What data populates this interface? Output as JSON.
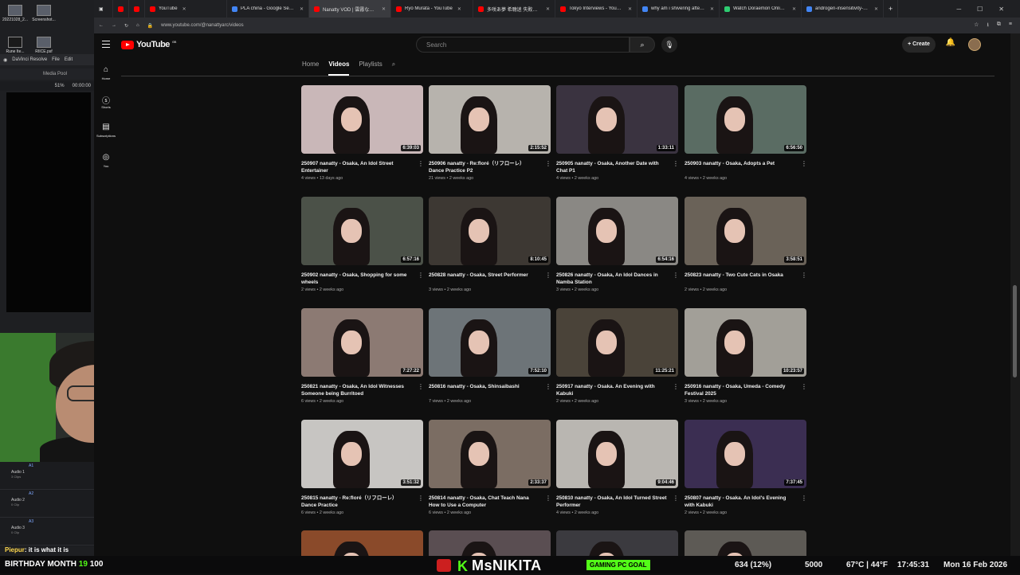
{
  "desktop": {
    "icons": [
      {
        "label": "20221028_2...",
        "icon": "image-file-icon"
      },
      {
        "label": "Screenshot...",
        "icon": "image-file-icon"
      },
      {
        "label": "Rune Ite...",
        "icon": "app-icon"
      },
      {
        "label": "RIICE.psf",
        "icon": "file-icon"
      }
    ],
    "resolve": {
      "app_name": "DaVinci Resolve",
      "menu": [
        "File",
        "Edit"
      ],
      "media_pool": "Media Pool",
      "zoom": "51%",
      "timecode": "00:00:00"
    },
    "audio_tracks": [
      {
        "tag": "A1",
        "name": "Audio 1",
        "clips": "3 Clips"
      },
      {
        "tag": "A2",
        "name": "Audio 2",
        "clips": "0 Clip"
      },
      {
        "tag": "A3",
        "name": "Audio 3",
        "clips": "0 Clip"
      }
    ]
  },
  "browser": {
    "tabs": [
      {
        "label": "YouTube",
        "color": "#ff0000"
      },
      {
        "label": "PLA china - Google Search",
        "color": "#4285f4"
      },
      {
        "label": "Nanatty VOD | 雲霧なな5...",
        "color": "#ff0000"
      },
      {
        "label": "Ryo Murata - YouTube",
        "color": "#ff0000"
      },
      {
        "label": "多咲あ夢 希聴迷 失敗回避...",
        "color": "#ff0000"
      },
      {
        "label": "Tokyo Interviews - YouTube",
        "color": "#ff0000"
      },
      {
        "label": "why am i shivering after fo...",
        "color": "#4285f4"
      },
      {
        "label": "Watch Doraemon Online in...",
        "color": "#2ecc71"
      },
      {
        "label": "androgen-insensitivity-syn...",
        "color": "#4285f4"
      }
    ],
    "active_tab_index": 2,
    "url": "www.youtube.com/@nanattyarc/videos"
  },
  "youtube": {
    "logo_text": "YouTube",
    "country_code": "GB",
    "search_placeholder": "Search",
    "create_label": "Create",
    "sidebar": [
      {
        "label": "Home",
        "icon": "home-icon"
      },
      {
        "label": "Shorts",
        "icon": "shorts-icon"
      },
      {
        "label": "Subscriptions",
        "icon": "subscriptions-icon"
      },
      {
        "label": "You",
        "icon": "user-icon"
      }
    ],
    "channel_tabs": [
      {
        "label": "Home",
        "selected": false
      },
      {
        "label": "Videos",
        "selected": true
      },
      {
        "label": "Playlists",
        "selected": false
      }
    ],
    "videos": [
      {
        "title": "250907    nanatty - Osaka, An Idol Street Entertainer",
        "meta": "4 views • 13 days ago",
        "duration": "6:39:03",
        "bg": "#c9b7b8"
      },
      {
        "title": "250906    nanatty - Re:floré（リフローレ） Dance Practice P2",
        "meta": "21 views • 2 weeks ago",
        "duration": "2:15:52",
        "bg": "#b7b3ad"
      },
      {
        "title": "250905    nanatty - Osaka, Another Date with Chat P1",
        "meta": "4 views • 2 weeks ago",
        "duration": "1:33:11",
        "bg": "#3a3340"
      },
      {
        "title": "250903    nanatty - Osaka, Adopts a Pet",
        "meta": "4 views • 2 weeks ago",
        "duration": "6:56:50",
        "bg": "#5a6c63"
      },
      {
        "title": "250902    nanatty - Osaka, Shopping for some wheels",
        "meta": "2 views • 2 weeks ago",
        "duration": "6:57:16",
        "bg": "#4b5148"
      },
      {
        "title": "250828    nanatty - Osaka, Street Performer",
        "meta": "3 views • 2 weeks ago",
        "duration": "8:10:45",
        "bg": "#3d3833"
      },
      {
        "title": "250826    nanatty - Osaka, An Idol Dances in Namba Station",
        "meta": "3 views • 2 weeks ago",
        "duration": "6:54:16",
        "bg": "#8a8884"
      },
      {
        "title": "250823    nanatty - Two Cute Cats in Osaka",
        "meta": "2 views • 2 weeks ago",
        "duration": "3:58:51",
        "bg": "#6a6258"
      },
      {
        "title": "250821    nanatty - Osaka, An Idol Witnesses Someone being Burritoed",
        "meta": "6 views • 2 weeks ago",
        "duration": "7:27:22",
        "bg": "#8c7a73"
      },
      {
        "title": "250816    nanatty - Osaka, Shinsaibashi",
        "meta": "7 views • 2 weeks ago",
        "duration": "7:52:10",
        "bg": "#6d7478"
      },
      {
        "title": "250917    nanatty - Osaka. An Evening with Kabuki",
        "meta": "2 views • 2 weeks ago",
        "duration": "11:25:21",
        "bg": "#4a4339"
      },
      {
        "title": "250916    nanatty - Osaka, Umeda - Comedy Festival 2025",
        "meta": "3 views • 2 weeks ago",
        "duration": "10:23:57",
        "bg": "#a29f98"
      },
      {
        "title": "250815    nanatty - Re:floré（リフローレ） Dance Practice",
        "meta": "6 views • 2 weeks ago",
        "duration": "3:51:32",
        "bg": "#c7c5c2"
      },
      {
        "title": "250814    nanatty - Osaka, Chat Teach Nana How to Use a Computer",
        "meta": "6 views • 2 weeks ago",
        "duration": "2:33:37",
        "bg": "#7b6d63"
      },
      {
        "title": "250810    nanatty - Osaka, An Idol Turned Street Performer",
        "meta": "4 views • 2 weeks ago",
        "duration": "9:04:46",
        "bg": "#b9b6b1"
      },
      {
        "title": "250807    nanatty - Osaka. An Idol's Evening with Kabuki",
        "meta": "2 views • 2 weeks ago",
        "duration": "7:37:45",
        "bg": "#3b2e52"
      },
      {
        "title": "",
        "meta": "",
        "duration": "",
        "bg": "#8a4a2a"
      },
      {
        "title": "",
        "meta": "",
        "duration": "",
        "bg": "#5a4e52"
      },
      {
        "title": "",
        "meta": "",
        "duration": "",
        "bg": "#3b3a3f"
      },
      {
        "title": "",
        "meta": "",
        "duration": "",
        "bg": "#5d5a55"
      }
    ]
  },
  "stream": {
    "chat_user": "Piepur",
    "chat_text": ": it is what it is",
    "banner": "BIRTHDAY MONTH",
    "banner_count": "19",
    "banner_pct": "100",
    "streamer": "MsNIKITA",
    "kick_letter": "K",
    "tag": "GAMING PC GOAL",
    "stat1": "634 (12%)",
    "stat2": "5000",
    "weather": "67°C | 44°F",
    "time": "17:45:31",
    "date": "Mon 16 Feb 2026"
  }
}
